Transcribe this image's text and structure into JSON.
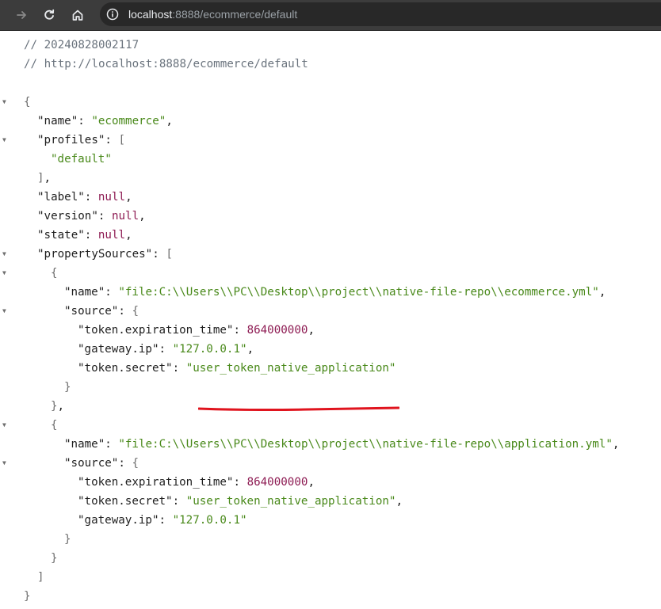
{
  "browser": {
    "url_host": "localhost",
    "url_rest": ":8888/ecommerce/default",
    "back_icon": "back-arrow-icon",
    "reload_icon": "reload-icon",
    "home_icon": "home-icon",
    "info_icon": "site-info-icon"
  },
  "header_comments": {
    "timestamp": "// 20240828002117",
    "url": "// http://localhost:8888/ecommerce/default"
  },
  "json": {
    "name_key": "\"name\"",
    "name_value": "\"ecommerce\"",
    "profiles_key": "\"profiles\"",
    "profiles_item": "\"default\"",
    "label_key": "\"label\"",
    "version_key": "\"version\"",
    "state_key": "\"state\"",
    "null_value": "null",
    "property_sources_key": "\"propertySources\"",
    "source_key": "\"source\"",
    "sources": [
      {
        "name_value": "\"file:C:\\\\Users\\\\PC\\\\Desktop\\\\project\\\\native-file-repo\\\\ecommerce.yml\"",
        "entries": [
          {
            "key": "\"token.expiration_time\"",
            "value": "864000000",
            "type": "num",
            "comma": ","
          },
          {
            "key": "\"gateway.ip\"",
            "value": "\"127.0.0.1\"",
            "type": "str",
            "comma": ","
          },
          {
            "key": "\"token.secret\"",
            "value": "\"user_token_native_application\"",
            "type": "str",
            "comma": ""
          }
        ]
      },
      {
        "name_value": "\"file:C:\\\\Users\\\\PC\\\\Desktop\\\\project\\\\native-file-repo\\\\application.yml\"",
        "entries": [
          {
            "key": "\"token.expiration_time\"",
            "value": "864000000",
            "type": "num",
            "comma": ","
          },
          {
            "key": "\"token.secret\"",
            "value": "\"user_token_native_application\"",
            "type": "str",
            "comma": ","
          },
          {
            "key": "\"gateway.ip\"",
            "value": "\"127.0.0.1\"",
            "type": "str",
            "comma": ""
          }
        ]
      }
    ]
  },
  "annotation": {
    "underline_color": "#e0141e"
  }
}
